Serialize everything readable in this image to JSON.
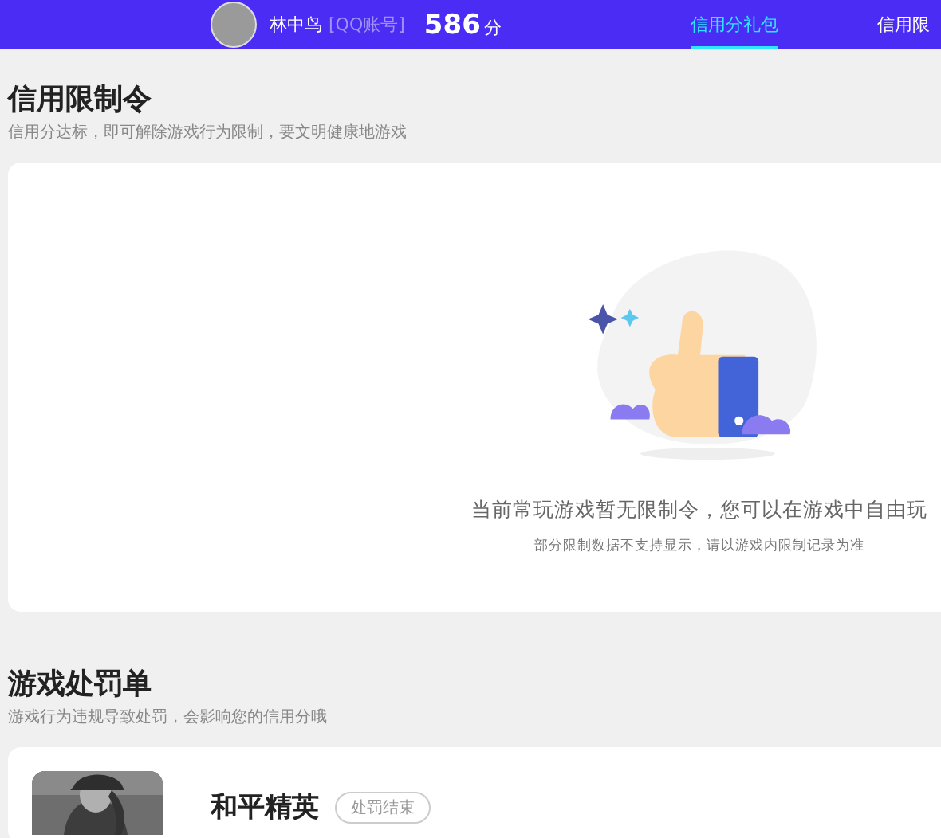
{
  "header": {
    "user_name": "林中鸟",
    "account_type": "[QQ账号]",
    "score": "586",
    "score_unit": "分",
    "tabs": [
      {
        "label": "信用分礼包",
        "selected": true
      },
      {
        "label": "信用限",
        "selected": false
      }
    ]
  },
  "restriction": {
    "title": "信用限制令",
    "subtitle": "信用分达标，即可解除游戏行为限制，要文明健康地游戏",
    "empty_message": "当前常玩游戏暂无限制令，您可以在游戏中自由玩",
    "note": "部分限制数据不支持显示，请以游戏内限制记录为准"
  },
  "penalty": {
    "title": "游戏处罚单",
    "subtitle": "游戏行为违规导致处罚，会影响您的信用分哦",
    "items": [
      {
        "game": "和平精英",
        "status": "处罚结束"
      }
    ]
  }
}
